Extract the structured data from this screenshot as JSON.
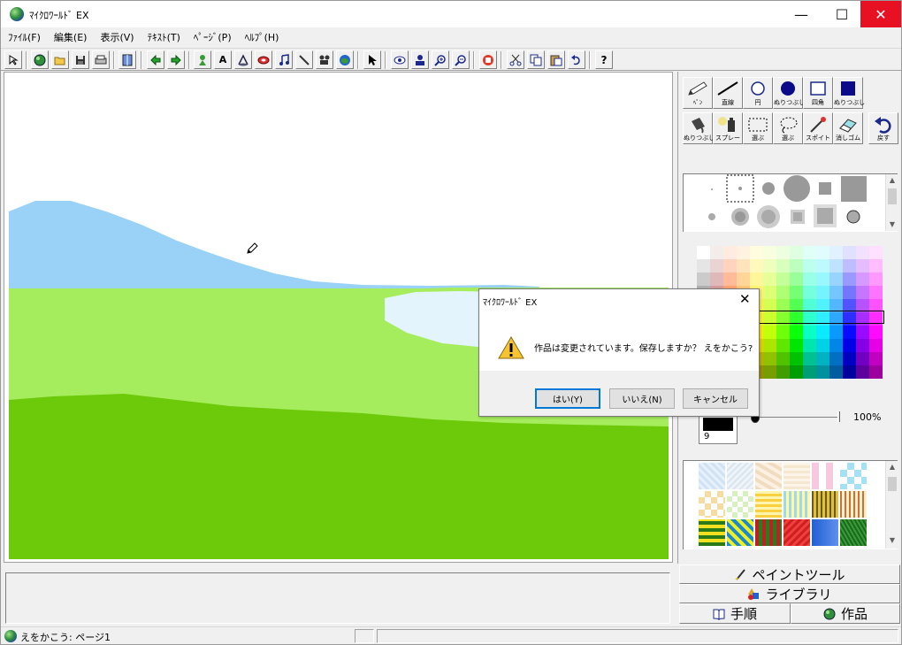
{
  "window": {
    "title": "ﾏｲｸﾛﾜｰﾙﾄﾞ EX",
    "minimize_glyph": "—",
    "maximize_glyph": "☐",
    "close_glyph": "✕"
  },
  "menu": [
    "ﾌｧｲﾙ(F)",
    "編集(E)",
    "表示(V)",
    "ﾃｷｽﾄ(T)",
    "ﾍﾟｰｼﾞ(P)",
    "ﾍﾙﾌﾟ(H)"
  ],
  "toolbar_icons": [
    "pointer-select-icon",
    "globe-icon",
    "open-folder-icon",
    "save-icon",
    "print-icon",
    "page-layout-icon",
    "arrow-left-icon",
    "arrow-right-icon",
    "character-icon",
    "text-box-icon",
    "script-icon",
    "gem-icon",
    "music-note-icon",
    "pen-tool-icon",
    "movie-camera-icon",
    "world-icon",
    "arrow-cursor-icon",
    "eye-icon",
    "stamp-icon",
    "zoom-in-icon",
    "zoom-out-icon",
    "stop-hand-icon",
    "scissors-icon",
    "copy-icon",
    "paste-icon",
    "undo-icon",
    "help-icon"
  ],
  "help_glyph": "?",
  "text_tool_glyph": "A",
  "paint_tools": [
    {
      "label": "ﾍﾟﾝ",
      "icon": "pen-icon"
    },
    {
      "label": "直線",
      "icon": "line-icon"
    },
    {
      "label": "円",
      "icon": "circle-icon"
    },
    {
      "label": "ぬりつぶし",
      "icon": "filled-circle-icon"
    },
    {
      "label": "四角",
      "icon": "rectangle-icon"
    },
    {
      "label": "ぬりつぶし",
      "icon": "filled-rectangle-icon"
    },
    {
      "label": "ぬりつぶし",
      "icon": "paint-bucket-icon"
    },
    {
      "label": "スプレー",
      "icon": "spray-icon"
    },
    {
      "label": "選ぶ",
      "icon": "rect-select-icon"
    },
    {
      "label": "選ぶ",
      "icon": "lasso-select-icon"
    },
    {
      "label": "スポイト",
      "icon": "eyedropper-icon"
    },
    {
      "label": "消しゴム",
      "icon": "eraser-icon"
    },
    {
      "label": "戻す",
      "icon": "undo-arrow-icon"
    }
  ],
  "colors": {
    "sky_blue": "#99d1f7",
    "light_green": "#a6ed5e",
    "dark_green": "#6dca0a",
    "pond": "#e4f4fc",
    "accent_blue": "#0078d7",
    "close_red": "#e81123"
  },
  "current_color": {
    "size_number": "9"
  },
  "opacity": {
    "value_percent": 100,
    "label": "100%"
  },
  "panel_tabs": [
    {
      "label": "ペイントツール",
      "icon": "brush-icon"
    },
    {
      "label": "ライブラリ",
      "icon": "shapes-icon"
    },
    {
      "label": "手順",
      "icon": "book-icon"
    },
    {
      "label": "作品",
      "icon": "globe-icon"
    }
  ],
  "status": {
    "text": "えをかこう:  ページ1"
  },
  "dialog": {
    "title": "ﾏｲｸﾛﾜｰﾙﾄﾞ EX",
    "close_glyph": "✕",
    "message": "作品は変更されています。保存しますか？ えをかこう?",
    "buttons": {
      "yes": "はい(Y)",
      "no": "いいえ(N)",
      "cancel": "キャンセル"
    }
  }
}
